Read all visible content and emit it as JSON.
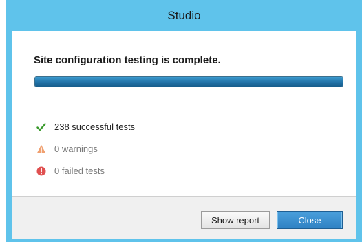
{
  "window": {
    "title": "Studio"
  },
  "main": {
    "heading": "Site configuration testing is complete.",
    "progress_fraction": 1.0,
    "results": [
      {
        "icon": "checkmark-icon",
        "text": "238 successful tests",
        "color": "#3a9a2c"
      },
      {
        "icon": "warning-icon",
        "text": "0 warnings",
        "color": "#f0a070"
      },
      {
        "icon": "error-icon",
        "text": "0 failed tests",
        "color": "#e05050"
      }
    ]
  },
  "footer": {
    "show_report_label": "Show report",
    "close_label": "Close"
  },
  "colors": {
    "titlebar": "#5fc3eb",
    "accent": "#2f82c4"
  }
}
